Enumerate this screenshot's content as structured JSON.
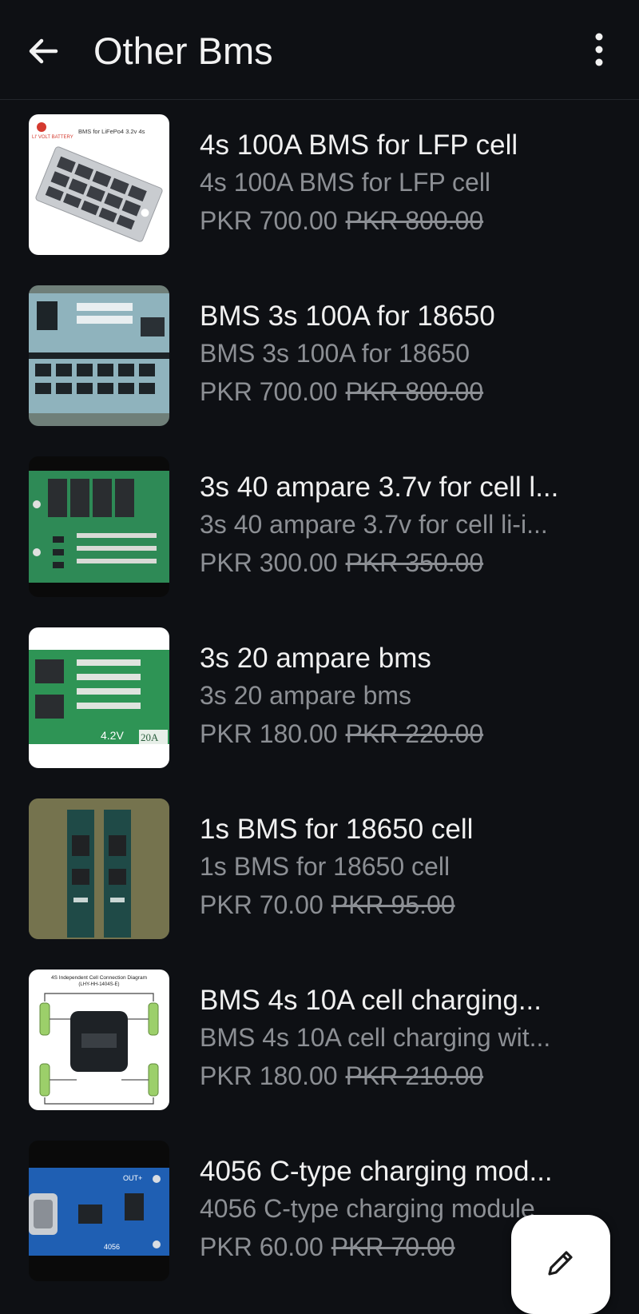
{
  "header": {
    "title": "Other Bms"
  },
  "icons": {
    "back": "arrow-left-icon",
    "menu": "more-vertical-icon",
    "fab": "pencil-edit-icon"
  },
  "products": [
    {
      "name": "4s 100A BMS for LFP cell",
      "description": "4s 100A BMS for LFP cell",
      "price": "PKR 700.00",
      "old_price": "PKR 800.00",
      "thumb_caption": "BMS for LiFePo4 3.2v 4s",
      "thumb_brand": "LI' VOLT BATTERY"
    },
    {
      "name": "BMS 3s 100A for 18650",
      "description": "BMS 3s 100A for 18650",
      "price": "PKR 700.00",
      "old_price": "PKR 800.00"
    },
    {
      "name": "3s 40 ampare 3.7v for cell l...",
      "description": "3s 40 ampare 3.7v for cell li-i...",
      "price": "PKR 300.00",
      "old_price": "PKR 350.00"
    },
    {
      "name": "3s 20 ampare bms",
      "description": "3s 20 ampare bms",
      "price": "PKR 180.00",
      "old_price": "PKR 220.00",
      "thumb_label_1": "4.2V",
      "thumb_label_2": "20A"
    },
    {
      "name": "1s BMS for 18650 cell",
      "description": "1s BMS for 18650 cell",
      "price": "PKR 70.00",
      "old_price": "PKR 95.00"
    },
    {
      "name": "BMS 4s 10A cell charging...",
      "description": "BMS 4s 10A cell charging wit...",
      "price": "PKR 180.00",
      "old_price": "PKR 210.00",
      "thumb_caption": "4S Independent Cell Connection Diagram",
      "thumb_subcaption": "(LHY-HH-1404S-E)"
    },
    {
      "name": "4056 C-type charging mod...",
      "description": "4056 C-type charging module",
      "price": "PKR 60.00",
      "old_price": "PKR 70.00",
      "thumb_label_1": "OUT+",
      "thumb_label_2": "4056"
    }
  ],
  "colors": {
    "background": "#0e1014",
    "text_primary": "#f0f0f0",
    "text_secondary": "#8c8f94",
    "fab_background": "#ffffff"
  }
}
